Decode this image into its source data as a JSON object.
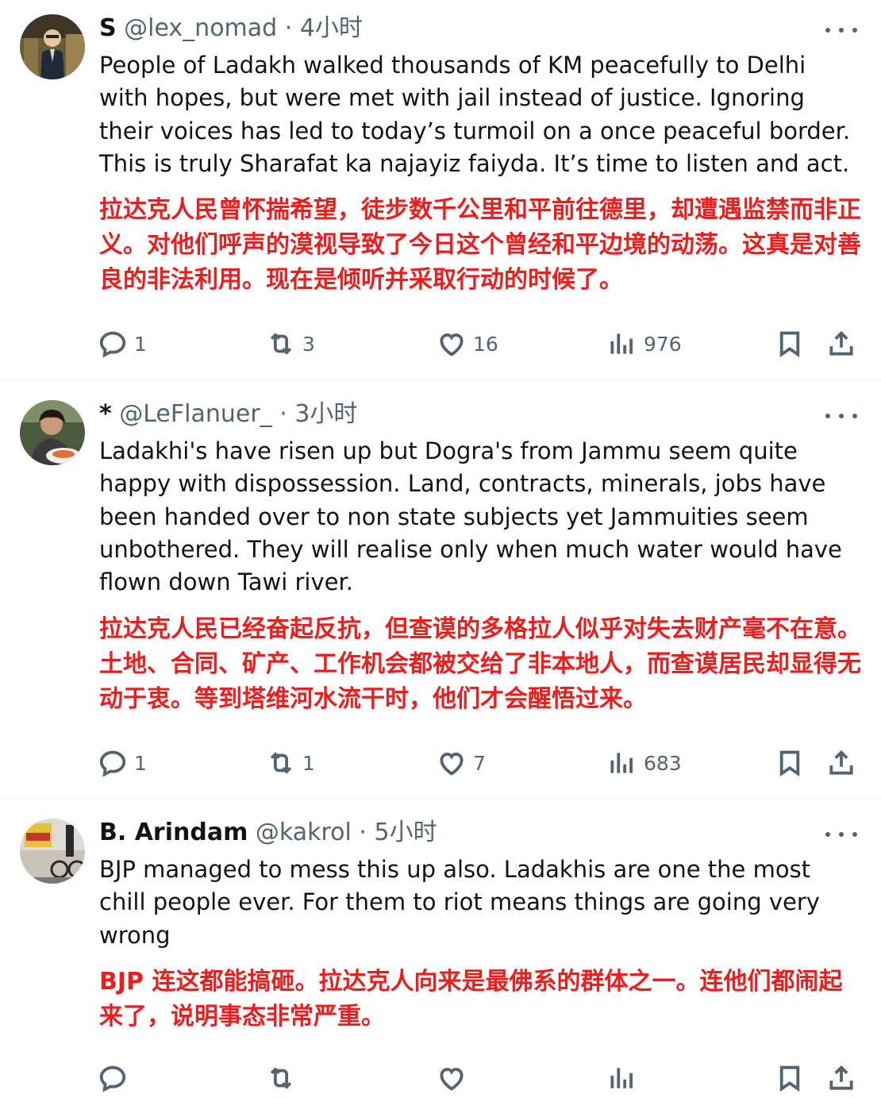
{
  "tweets": [
    {
      "name": "S",
      "handle": "@lex_nomad",
      "separator": "·",
      "time": "4小时",
      "text": "People of Ladakh walked thousands of KM peacefully to Delhi with hopes, but were met with jail instead of justice. Ignoring their voices has led to today’s turmoil on a once peaceful border. This is truly Sharafat ka najayiz faiyda. It’s time to listen and act.",
      "translation": "拉达克人民曾怀揣希望，徒步数千公里和平前往德里，却遭遇监禁而非正义。对他们呼声的漠视导致了今日这个曾经和平边境的动荡。这真是对善良的非法利用。现在是倾听并采取行动的时候了。",
      "replies": "1",
      "reposts": "3",
      "likes": "16",
      "views": "976"
    },
    {
      "name": "*",
      "handle": "@LeFlanuer_",
      "separator": "·",
      "time": "3小时",
      "text": "Ladakhi's have risen up but Dogra's from Jammu seem quite happy with dispossession. Land, contracts, minerals, jobs have been handed over to non state subjects yet Jammuities seem unbothered. They will realise only when much water would have flown down Tawi river.",
      "translation": "拉达克人民已经奋起反抗，但查谟的多格拉人似乎对失去财产毫不在意。土地、合同、矿产、工作机会都被交给了非本地人，而查谟居民却显得无动于衷。等到塔维河水流干时，他们才会醒悟过来。",
      "replies": "1",
      "reposts": "1",
      "likes": "7",
      "views": "683"
    },
    {
      "name": "B. Arindam",
      "handle": "@kakrol",
      "separator": "·",
      "time": "5小时",
      "text": "BJP managed to mess this up also.  Ladakhis are one the most chill people ever. For them to riot means things are going very wrong",
      "translation": "BJP 连这都能搞砸。拉达克人向来是最佛系的群体之一。连他们都闹起来了，说明事态非常严重。"
    }
  ],
  "colors": {
    "text": "#0f1419",
    "secondary": "#536471",
    "translation": "#ef1c1c",
    "divider": "#eff3f4"
  },
  "icons": [
    "reply-icon",
    "repost-icon",
    "like-icon",
    "views-icon",
    "bookmark-icon",
    "share-icon",
    "more-icon"
  ]
}
